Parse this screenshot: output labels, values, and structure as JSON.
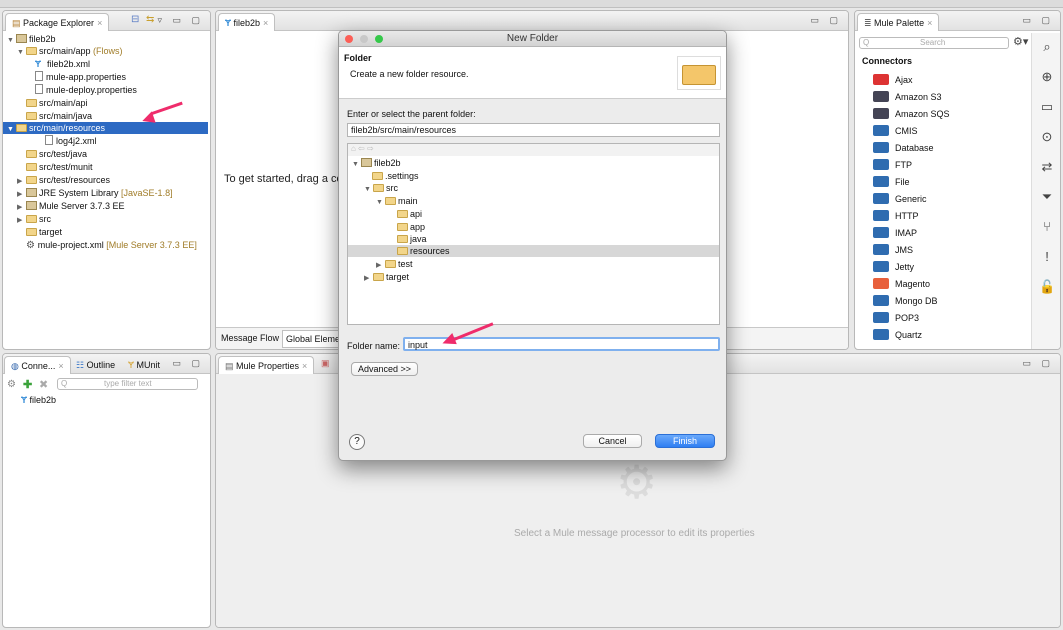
{
  "package_explorer": {
    "tab": "Package Explorer",
    "tree": [
      "fileb2b",
      "src/main/app",
      "fileb2b.xml",
      "mule-app.properties",
      "mule-deploy.properties",
      "src/main/api",
      "src/main/java",
      "src/main/resources",
      "log4j2.xml",
      "src/test/java",
      "src/test/munit",
      "src/test/resources",
      "JRE System Library",
      "Mule Server 3.7.3 EE",
      "src",
      "target",
      "mule-project.xml"
    ],
    "decorations": {
      "flows": "(Flows)",
      "jre": "[JavaSE-1.8]",
      "mule_project": "[Mule Server 3.7.3 EE]"
    }
  },
  "editor": {
    "tab": "fileb2b",
    "hint": "To get started, drag a co",
    "bottom_tabs": [
      "Message Flow",
      "Global Elemen"
    ]
  },
  "palette": {
    "tab": "Mule Palette",
    "search_placeholder": "Search",
    "section": "Connectors",
    "items": [
      "Ajax",
      "Amazon S3",
      "Amazon SQS",
      "CMIS",
      "Database",
      "FTP",
      "File",
      "Generic",
      "HTTP",
      "IMAP",
      "JMS",
      "Jetty",
      "Magento",
      "Mongo DB",
      "POP3",
      "Quartz"
    ]
  },
  "connections": {
    "tabs": [
      "Conne...",
      "Outline",
      "MUnit"
    ],
    "filter_placeholder": "type filter text",
    "item": "fileb2b"
  },
  "properties": {
    "tab": "Mule Properties",
    "empty_message": "Select a Mule message processor to edit its properties"
  },
  "dialog": {
    "title": "New Folder",
    "heading": "Folder",
    "description": "Create a new folder resource.",
    "parent_label": "Enter or select the parent folder:",
    "parent_value": "fileb2b/src/main/resources",
    "tree": [
      "fileb2b",
      ".settings",
      "src",
      "main",
      "api",
      "app",
      "java",
      "resources",
      "test",
      "target"
    ],
    "folder_name_label": "Folder name:",
    "folder_name_value": "input",
    "advanced": "Advanced >>",
    "help": "?",
    "cancel": "Cancel",
    "finish": "Finish"
  },
  "colors": {
    "selection": "#2d6ac3",
    "annotation_arrow": "#ef2c6b",
    "finish_button": "#3d8ef5"
  }
}
